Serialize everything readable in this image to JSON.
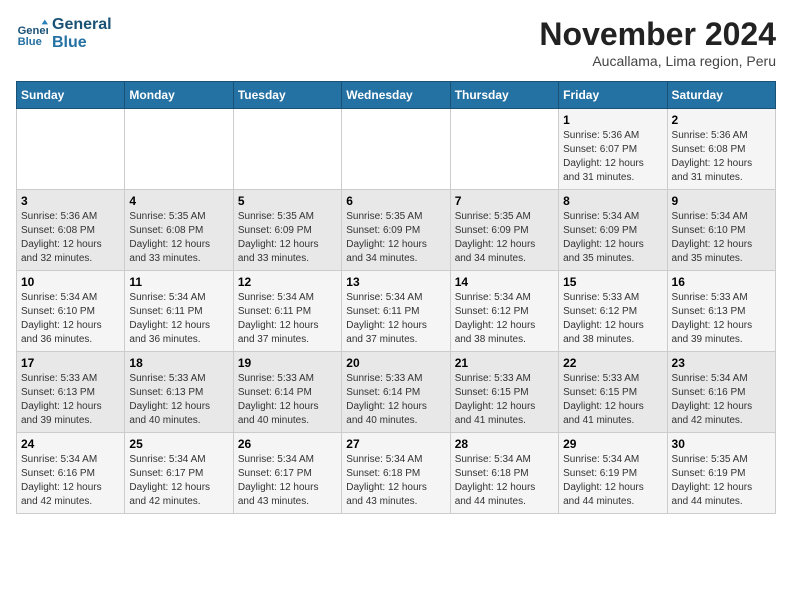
{
  "logo": {
    "line1": "General",
    "line2": "Blue"
  },
  "title": "November 2024",
  "subtitle": "Aucallama, Lima region, Peru",
  "days_of_week": [
    "Sunday",
    "Monday",
    "Tuesday",
    "Wednesday",
    "Thursday",
    "Friday",
    "Saturday"
  ],
  "weeks": [
    [
      {
        "day": "",
        "info": ""
      },
      {
        "day": "",
        "info": ""
      },
      {
        "day": "",
        "info": ""
      },
      {
        "day": "",
        "info": ""
      },
      {
        "day": "",
        "info": ""
      },
      {
        "day": "1",
        "info": "Sunrise: 5:36 AM\nSunset: 6:07 PM\nDaylight: 12 hours and 31 minutes."
      },
      {
        "day": "2",
        "info": "Sunrise: 5:36 AM\nSunset: 6:08 PM\nDaylight: 12 hours and 31 minutes."
      }
    ],
    [
      {
        "day": "3",
        "info": "Sunrise: 5:36 AM\nSunset: 6:08 PM\nDaylight: 12 hours and 32 minutes."
      },
      {
        "day": "4",
        "info": "Sunrise: 5:35 AM\nSunset: 6:08 PM\nDaylight: 12 hours and 33 minutes."
      },
      {
        "day": "5",
        "info": "Sunrise: 5:35 AM\nSunset: 6:09 PM\nDaylight: 12 hours and 33 minutes."
      },
      {
        "day": "6",
        "info": "Sunrise: 5:35 AM\nSunset: 6:09 PM\nDaylight: 12 hours and 34 minutes."
      },
      {
        "day": "7",
        "info": "Sunrise: 5:35 AM\nSunset: 6:09 PM\nDaylight: 12 hours and 34 minutes."
      },
      {
        "day": "8",
        "info": "Sunrise: 5:34 AM\nSunset: 6:09 PM\nDaylight: 12 hours and 35 minutes."
      },
      {
        "day": "9",
        "info": "Sunrise: 5:34 AM\nSunset: 6:10 PM\nDaylight: 12 hours and 35 minutes."
      }
    ],
    [
      {
        "day": "10",
        "info": "Sunrise: 5:34 AM\nSunset: 6:10 PM\nDaylight: 12 hours and 36 minutes."
      },
      {
        "day": "11",
        "info": "Sunrise: 5:34 AM\nSunset: 6:11 PM\nDaylight: 12 hours and 36 minutes."
      },
      {
        "day": "12",
        "info": "Sunrise: 5:34 AM\nSunset: 6:11 PM\nDaylight: 12 hours and 37 minutes."
      },
      {
        "day": "13",
        "info": "Sunrise: 5:34 AM\nSunset: 6:11 PM\nDaylight: 12 hours and 37 minutes."
      },
      {
        "day": "14",
        "info": "Sunrise: 5:34 AM\nSunset: 6:12 PM\nDaylight: 12 hours and 38 minutes."
      },
      {
        "day": "15",
        "info": "Sunrise: 5:33 AM\nSunset: 6:12 PM\nDaylight: 12 hours and 38 minutes."
      },
      {
        "day": "16",
        "info": "Sunrise: 5:33 AM\nSunset: 6:13 PM\nDaylight: 12 hours and 39 minutes."
      }
    ],
    [
      {
        "day": "17",
        "info": "Sunrise: 5:33 AM\nSunset: 6:13 PM\nDaylight: 12 hours and 39 minutes."
      },
      {
        "day": "18",
        "info": "Sunrise: 5:33 AM\nSunset: 6:13 PM\nDaylight: 12 hours and 40 minutes."
      },
      {
        "day": "19",
        "info": "Sunrise: 5:33 AM\nSunset: 6:14 PM\nDaylight: 12 hours and 40 minutes."
      },
      {
        "day": "20",
        "info": "Sunrise: 5:33 AM\nSunset: 6:14 PM\nDaylight: 12 hours and 40 minutes."
      },
      {
        "day": "21",
        "info": "Sunrise: 5:33 AM\nSunset: 6:15 PM\nDaylight: 12 hours and 41 minutes."
      },
      {
        "day": "22",
        "info": "Sunrise: 5:33 AM\nSunset: 6:15 PM\nDaylight: 12 hours and 41 minutes."
      },
      {
        "day": "23",
        "info": "Sunrise: 5:34 AM\nSunset: 6:16 PM\nDaylight: 12 hours and 42 minutes."
      }
    ],
    [
      {
        "day": "24",
        "info": "Sunrise: 5:34 AM\nSunset: 6:16 PM\nDaylight: 12 hours and 42 minutes."
      },
      {
        "day": "25",
        "info": "Sunrise: 5:34 AM\nSunset: 6:17 PM\nDaylight: 12 hours and 42 minutes."
      },
      {
        "day": "26",
        "info": "Sunrise: 5:34 AM\nSunset: 6:17 PM\nDaylight: 12 hours and 43 minutes."
      },
      {
        "day": "27",
        "info": "Sunrise: 5:34 AM\nSunset: 6:18 PM\nDaylight: 12 hours and 43 minutes."
      },
      {
        "day": "28",
        "info": "Sunrise: 5:34 AM\nSunset: 6:18 PM\nDaylight: 12 hours and 44 minutes."
      },
      {
        "day": "29",
        "info": "Sunrise: 5:34 AM\nSunset: 6:19 PM\nDaylight: 12 hours and 44 minutes."
      },
      {
        "day": "30",
        "info": "Sunrise: 5:35 AM\nSunset: 6:19 PM\nDaylight: 12 hours and 44 minutes."
      }
    ]
  ]
}
